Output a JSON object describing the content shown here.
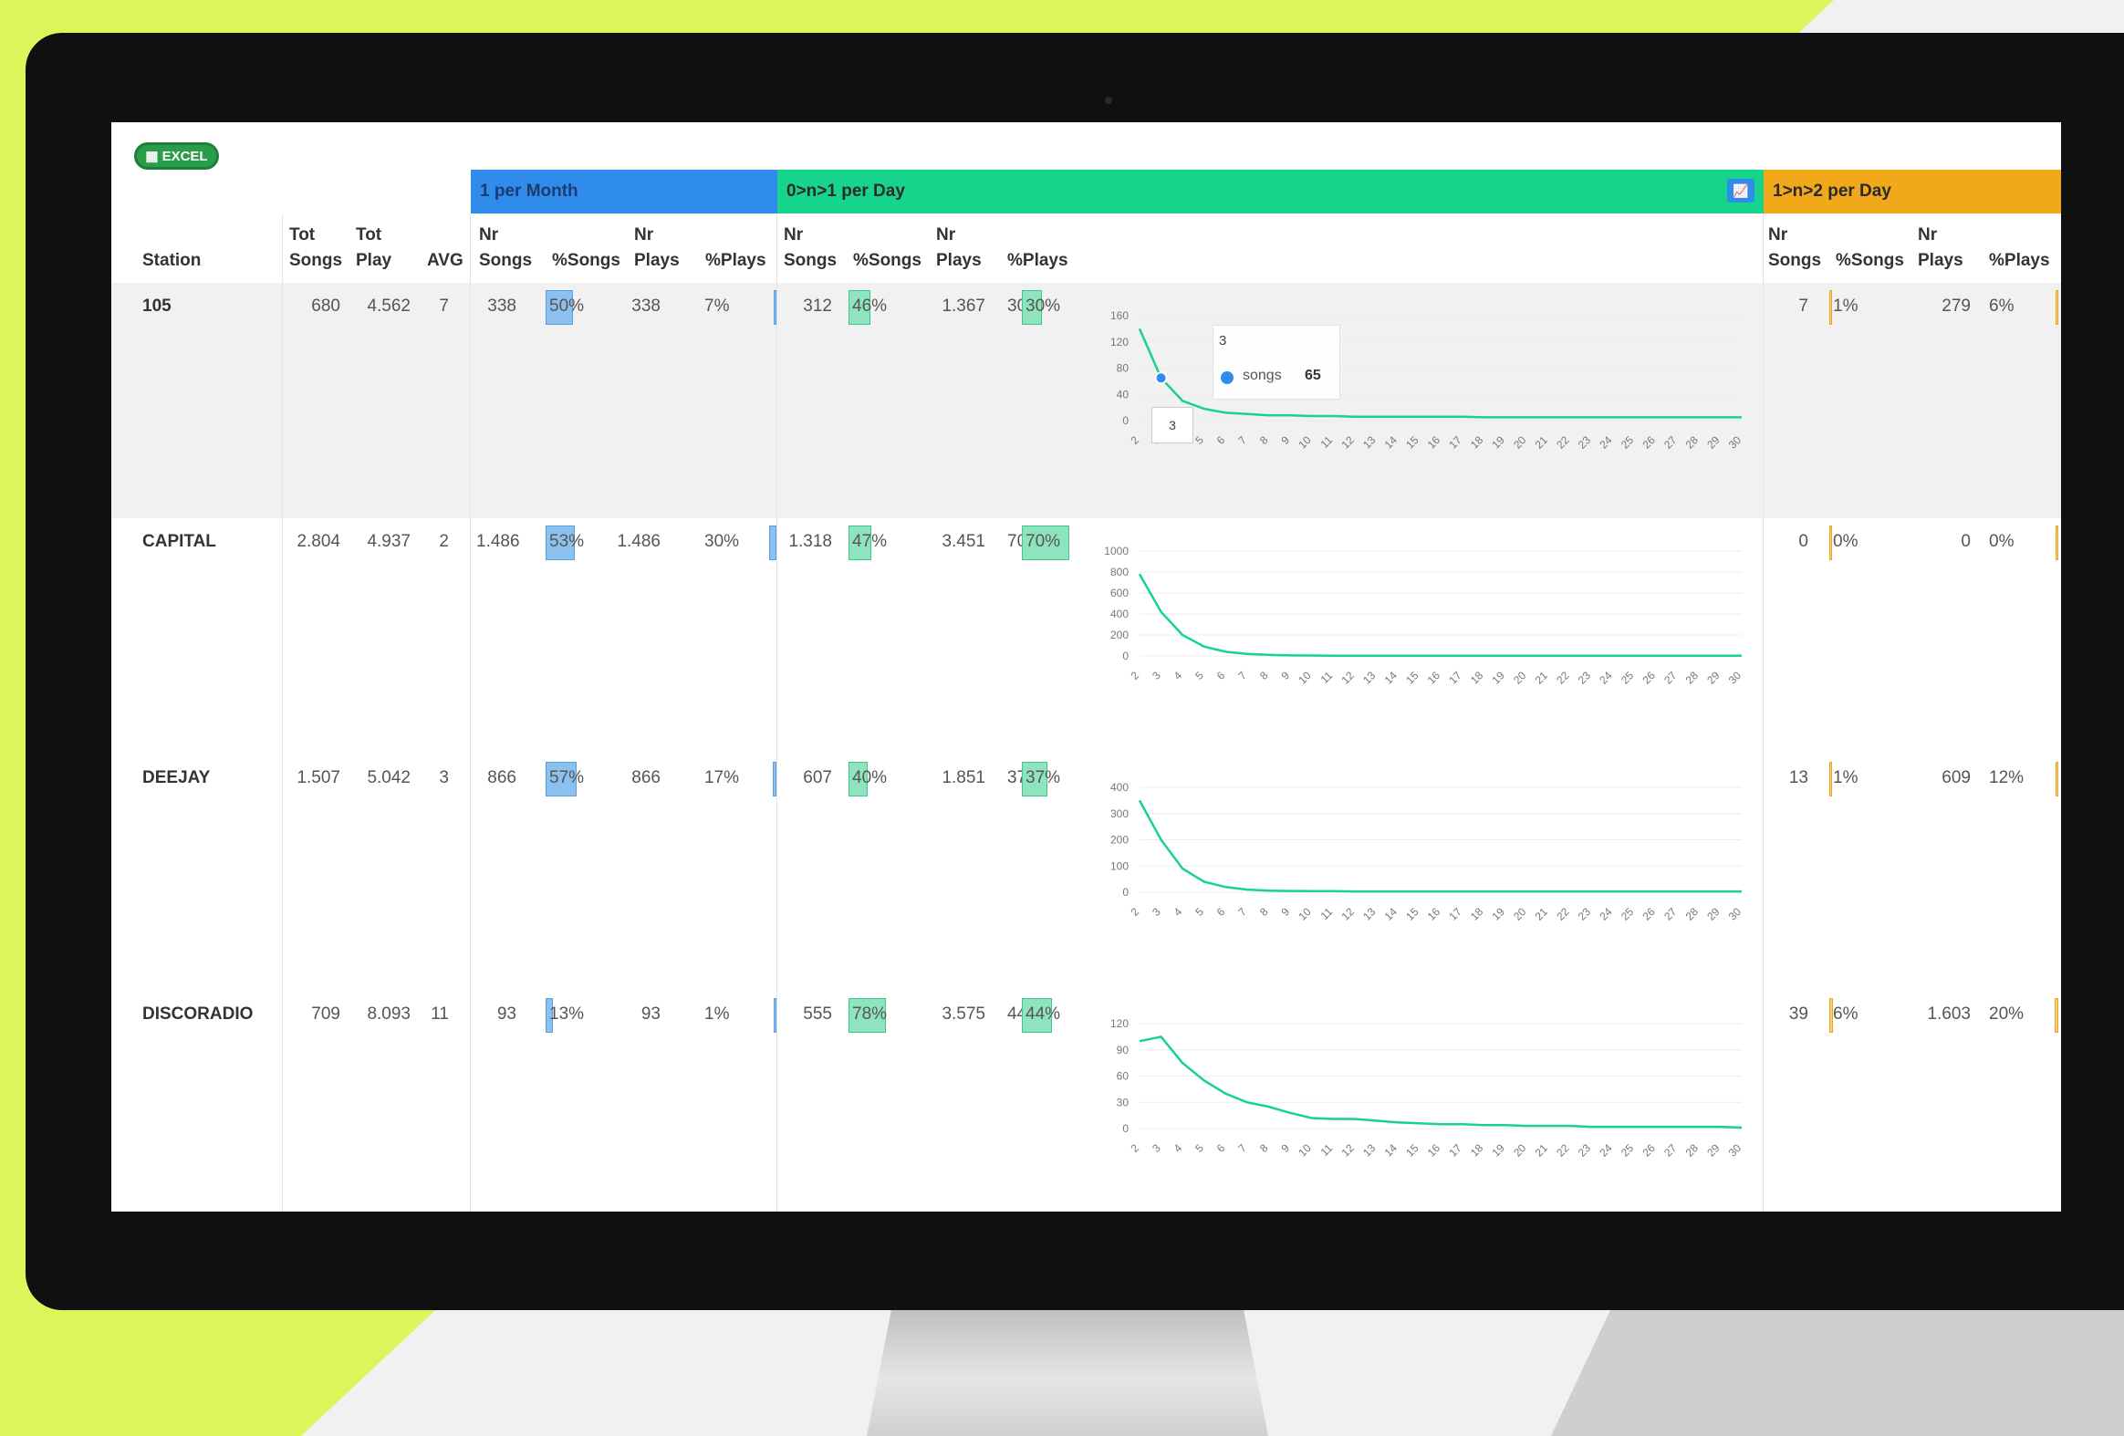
{
  "toolbar": {
    "excel_label": "EXCEL",
    "excel_icon": "spreadsheet-icon"
  },
  "bands": {
    "blue": "1 per Month",
    "green": "0>n>1 per Day",
    "orange": "1>n>2 per Day",
    "chart_icon": "line-chart-icon"
  },
  "colors": {
    "blue": "#2f8cea",
    "green": "#17d48c",
    "orange": "#f1a81a",
    "excel": "#2a9d4a"
  },
  "headers": {
    "station": "Station",
    "tot_songs_1": "Tot",
    "tot_songs_2": "Songs",
    "tot_play_1": "Tot",
    "tot_play_2": "Play",
    "avg": "AVG",
    "nr": "Nr",
    "songs": "Songs",
    "pct_songs": "%Songs",
    "plays": "Plays",
    "pct_plays": "%Plays"
  },
  "rows": [
    {
      "station": "105",
      "tot_songs": "680",
      "tot_play": "4.562",
      "avg": "7",
      "m_songs": "338",
      "m_pct_songs": "50%",
      "m_plays": "338",
      "m_pct_plays": "7%",
      "d_songs": "312",
      "d_pct_songs": "46%",
      "d_plays": "1.367",
      "d_pct_plays": "30%",
      "o_songs": "7",
      "o_pct_songs": "1%",
      "o_plays": "279",
      "o_pct_plays": "6%",
      "m_fill_songs": 0.5,
      "m_fill_plays": 0.07,
      "d_fill_songs": 0.46,
      "d_fill_plays": 0.3,
      "o_fill_songs": 0.01,
      "o_fill_plays": 0.06
    },
    {
      "station": "CAPITAL",
      "tot_songs": "2.804",
      "tot_play": "4.937",
      "avg": "2",
      "m_songs": "1.486",
      "m_pct_songs": "53%",
      "m_plays": "1.486",
      "m_pct_plays": "30%",
      "d_songs": "1.318",
      "d_pct_songs": "47%",
      "d_plays": "3.451",
      "d_pct_plays": "70%",
      "o_songs": "0",
      "o_pct_songs": "0%",
      "o_plays": "0",
      "o_pct_plays": "0%",
      "m_fill_songs": 0.53,
      "m_fill_plays": 0.3,
      "d_fill_songs": 0.47,
      "d_fill_plays": 0.7,
      "o_fill_songs": 0,
      "o_fill_plays": 0
    },
    {
      "station": "DEEJAY",
      "tot_songs": "1.507",
      "tot_play": "5.042",
      "avg": "3",
      "m_songs": "866",
      "m_pct_songs": "57%",
      "m_plays": "866",
      "m_pct_plays": "17%",
      "d_songs": "607",
      "d_pct_songs": "40%",
      "d_plays": "1.851",
      "d_pct_plays": "37%",
      "o_songs": "13",
      "o_pct_songs": "1%",
      "o_plays": "609",
      "o_pct_plays": "12%",
      "m_fill_songs": 0.57,
      "m_fill_plays": 0.17,
      "d_fill_songs": 0.4,
      "d_fill_plays": 0.37,
      "o_fill_songs": 0.01,
      "o_fill_plays": 0.12
    },
    {
      "station": "DISCORADIO",
      "tot_songs": "709",
      "tot_play": "8.093",
      "avg": "11",
      "m_songs": "93",
      "m_pct_songs": "13%",
      "m_plays": "93",
      "m_pct_plays": "1%",
      "d_songs": "555",
      "d_pct_songs": "78%",
      "d_plays": "3.575",
      "d_pct_plays": "44%",
      "o_songs": "39",
      "o_pct_songs": "6%",
      "o_plays": "1.603",
      "o_pct_plays": "20%",
      "m_fill_songs": 0.13,
      "m_fill_plays": 0.01,
      "d_fill_songs": 0.78,
      "d_fill_plays": 0.44,
      "o_fill_songs": 0.06,
      "o_fill_plays": 0.2
    }
  ],
  "chart_data": [
    {
      "type": "line",
      "x": [
        2,
        3,
        4,
        5,
        6,
        7,
        8,
        9,
        10,
        11,
        12,
        13,
        14,
        15,
        16,
        17,
        18,
        19,
        20,
        21,
        22,
        23,
        24,
        25,
        26,
        27,
        28,
        29,
        30
      ],
      "series": [
        {
          "values": [
            140,
            65,
            30,
            18,
            12,
            10,
            8,
            8,
            7,
            7,
            6,
            6,
            6,
            6,
            6,
            6,
            5,
            5,
            5,
            5,
            5,
            5,
            5,
            5,
            5,
            5,
            5,
            5,
            5
          ]
        }
      ],
      "yticks": [
        "160",
        "120",
        "80",
        "40",
        "0"
      ],
      "ylim": [
        0,
        160
      ],
      "tooltip": {
        "x": "3",
        "series": "songs",
        "value": "65"
      }
    },
    {
      "type": "line",
      "x": [
        2,
        3,
        4,
        5,
        6,
        7,
        8,
        9,
        10,
        11,
        12,
        13,
        14,
        15,
        16,
        17,
        18,
        19,
        20,
        21,
        22,
        23,
        24,
        25,
        26,
        27,
        28,
        29,
        30
      ],
      "series": [
        {
          "values": [
            780,
            420,
            200,
            90,
            40,
            20,
            10,
            5,
            4,
            3,
            3,
            2,
            2,
            2,
            2,
            2,
            2,
            2,
            2,
            2,
            2,
            2,
            2,
            2,
            2,
            2,
            2,
            2,
            2
          ]
        }
      ],
      "yticks": [
        "1000",
        "800",
        "600",
        "400",
        "200",
        "0"
      ],
      "ylim": [
        0,
        1000
      ]
    },
    {
      "type": "line",
      "x": [
        2,
        3,
        4,
        5,
        6,
        7,
        8,
        9,
        10,
        11,
        12,
        13,
        14,
        15,
        16,
        17,
        18,
        19,
        20,
        21,
        22,
        23,
        24,
        25,
        26,
        27,
        28,
        29,
        30
      ],
      "series": [
        {
          "values": [
            350,
            200,
            90,
            40,
            20,
            10,
            6,
            5,
            4,
            4,
            3,
            3,
            3,
            3,
            3,
            3,
            3,
            3,
            3,
            3,
            3,
            3,
            3,
            3,
            3,
            3,
            3,
            3,
            3
          ]
        }
      ],
      "yticks": [
        "400",
        "300",
        "200",
        "100",
        "0"
      ],
      "ylim": [
        0,
        400
      ]
    },
    {
      "type": "line",
      "x": [
        2,
        3,
        4,
        5,
        6,
        7,
        8,
        9,
        10,
        11,
        12,
        13,
        14,
        15,
        16,
        17,
        18,
        19,
        20,
        21,
        22,
        23,
        24,
        25,
        26,
        27,
        28,
        29,
        30
      ],
      "series": [
        {
          "values": [
            100,
            105,
            75,
            55,
            40,
            30,
            25,
            18,
            12,
            11,
            11,
            9,
            7,
            6,
            5,
            5,
            4,
            4,
            3,
            3,
            3,
            2,
            2,
            2,
            2,
            2,
            2,
            2,
            1
          ]
        }
      ],
      "yticks": [
        "120",
        "90",
        "60",
        "30",
        "0"
      ],
      "ylim": [
        0,
        120
      ]
    }
  ]
}
